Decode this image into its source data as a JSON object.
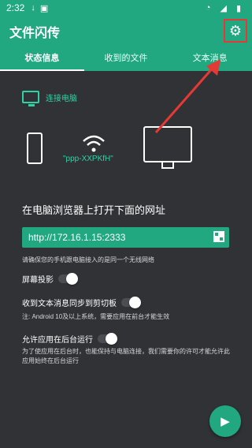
{
  "status_bar": {
    "time": "2:32",
    "icons": [
      "download-icon",
      "text-icon",
      "wifi-icon",
      "signal-icon",
      "battery-icon"
    ]
  },
  "app": {
    "title": "文件闪传",
    "settings_icon": "gear-icon",
    "colors": {
      "primary": "#22a881",
      "background": "#303236",
      "accent": "#2ed3a4",
      "highlight": "#e53935"
    }
  },
  "tabs": [
    {
      "label": "状态信息",
      "active": true
    },
    {
      "label": "收到的文件",
      "active": false
    },
    {
      "label": "文本消息",
      "active": false
    }
  ],
  "connection": {
    "label": "连接电脑",
    "ssid": "\"ppp-XXPKfH\"",
    "heading": "在电脑浏览器上打开下面的网址",
    "url": "http://172.16.1.15:2333",
    "hint": "请确保您的手机跟电脑接入的是同一个无线网络"
  },
  "settings": {
    "screen_cast": {
      "label": "屏幕投影",
      "enabled": false
    },
    "clipboard_sync": {
      "label": "收到文本消息同步到剪切板",
      "enabled": false,
      "note": "注: Android 10及以上系统，需要应用在前台才能生效"
    },
    "background_run": {
      "label": "允许应用在后台运行",
      "enabled": false,
      "note": "为了使应用在后台时，也能保持与电脑连接，我们需要你的许可才能允许此应用始终在后台运行"
    }
  },
  "fab": {
    "icon": "play-icon"
  }
}
